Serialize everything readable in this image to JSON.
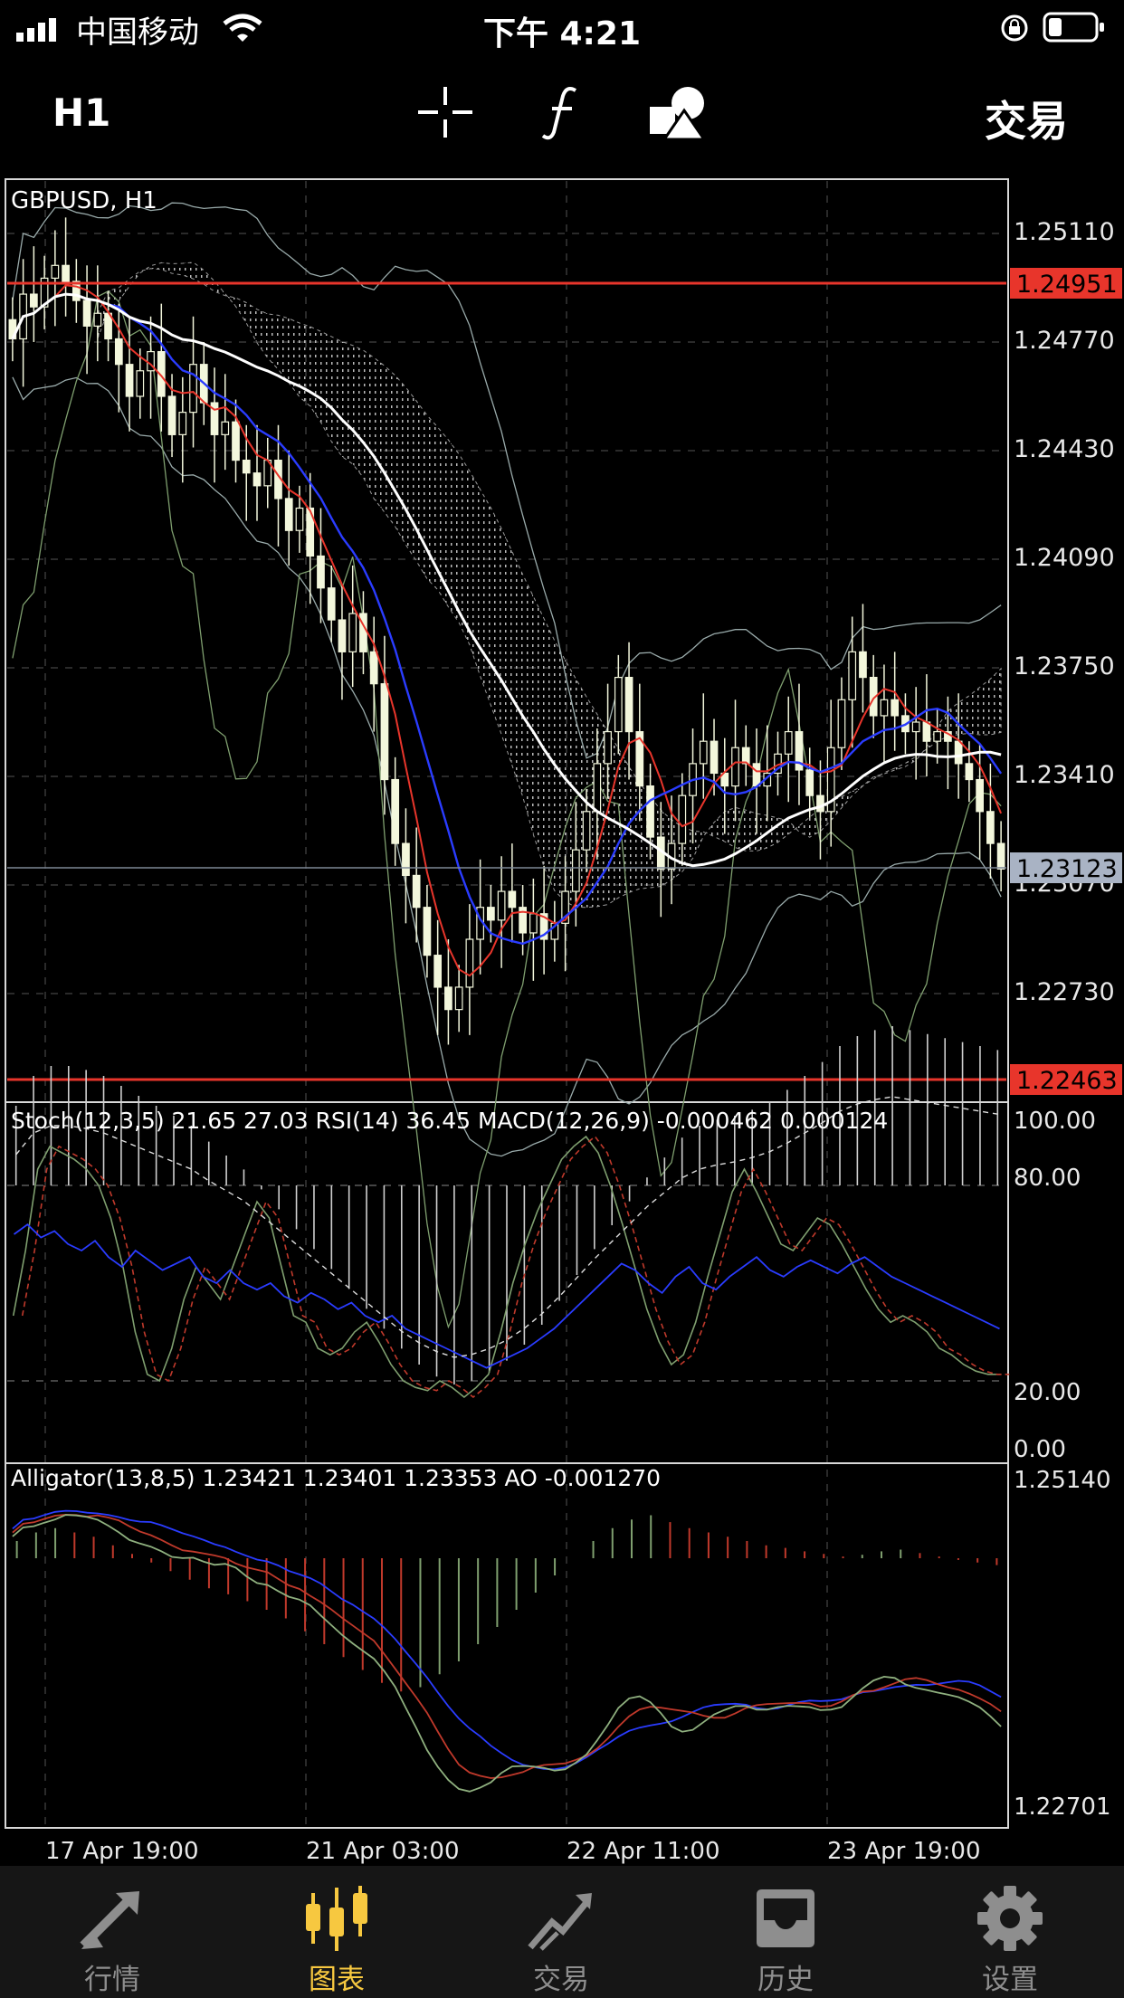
{
  "status_bar": {
    "carrier": "中国移动",
    "time": "下午 4:21"
  },
  "toolbar": {
    "timeframe": "H1",
    "trade_label": "交易",
    "icons": [
      "crosshair-icon",
      "function-icon",
      "shapes-icon"
    ]
  },
  "main_chart": {
    "symbol_label": "GBPUSD, H1",
    "price_labels": [
      "1.25110",
      "1.24770",
      "1.24430",
      "1.24090",
      "1.23750",
      "1.23410",
      "1.23070",
      "1.22730"
    ],
    "levels": {
      "upper_red": "1.24951",
      "lower_red": "1.22463",
      "current": "1.23123"
    }
  },
  "indicator1": {
    "label": "Stoch(12,3,5) 21.65 27.03 RSI(14) 36.45 MACD(12,26,9) -0.000462 0.000124",
    "scale": [
      "100.00",
      "80.00",
      "20.00",
      "0.00"
    ]
  },
  "indicator2": {
    "label": "Alligator(13,8,5) 1.23421 1.23401 1.23353 AO -0.001270",
    "scale": [
      "1.25140",
      "1.22701"
    ]
  },
  "time_axis": [
    "17 Apr 19:00",
    "21 Apr 03:00",
    "22 Apr 11:00",
    "23 Apr 19:00"
  ],
  "chart_data": {
    "type": "candlestick",
    "symbol": "GBPUSD",
    "ylim": [
      1.2246,
      1.2528
    ],
    "close": [
      1.2478,
      1.2492,
      1.2488,
      1.2497,
      1.2501,
      1.2496,
      1.249,
      1.2482,
      1.2486,
      1.2478,
      1.247,
      1.246,
      1.2468,
      1.2474,
      1.246,
      1.2448,
      1.2455,
      1.247,
      1.2458,
      1.2448,
      1.2452,
      1.244,
      1.2436,
      1.2432,
      1.244,
      1.2428,
      1.2418,
      1.2425,
      1.241,
      1.24,
      1.239,
      1.238,
      1.2392,
      1.238,
      1.237,
      1.234,
      1.232,
      1.231,
      1.23,
      1.2285,
      1.2275,
      1.2268,
      1.2275,
      1.229,
      1.23,
      1.2296,
      1.2305,
      1.23,
      1.2292,
      1.2298,
      1.229,
      1.2295,
      1.2305,
      1.2318,
      1.233,
      1.2345,
      1.2355,
      1.2372,
      1.2355,
      1.2338,
      1.2322,
      1.2312,
      1.232,
      1.2335,
      1.2345,
      1.2352,
      1.2342,
      1.2338,
      1.235,
      1.2345,
      1.2338,
      1.2342,
      1.2348,
      1.2355,
      1.2343,
      1.2335,
      1.233,
      1.235,
      1.2365,
      1.238,
      1.2372,
      1.236,
      1.2365,
      1.236,
      1.2355,
      1.2358,
      1.2352,
      1.2355,
      1.2352,
      1.2345,
      1.234,
      1.233,
      1.232,
      1.2312
    ],
    "stoch_main": [
      40,
      60,
      85,
      92,
      90,
      88,
      85,
      80,
      70,
      55,
      35,
      22,
      20,
      30,
      45,
      55,
      50,
      45,
      55,
      65,
      75,
      70,
      55,
      40,
      38,
      30,
      28,
      30,
      35,
      38,
      32,
      25,
      20,
      18,
      17,
      20,
      18,
      15,
      18,
      22,
      35,
      50,
      62,
      72,
      80,
      88,
      92,
      95,
      90,
      80,
      68,
      55,
      42,
      32,
      25,
      28,
      38,
      52,
      65,
      78,
      85,
      78,
      70,
      62,
      60,
      65,
      70,
      68,
      62,
      55,
      48,
      42,
      38,
      40,
      38,
      35,
      30,
      28,
      25,
      23,
      22,
      22
    ],
    "rsi": [
      65,
      68,
      64,
      66,
      62,
      60,
      63,
      58,
      55,
      60,
      57,
      54,
      56,
      58,
      52,
      50,
      54,
      50,
      48,
      50,
      46,
      44,
      47,
      45,
      42,
      44,
      40,
      38,
      40,
      36,
      34,
      32,
      30,
      28,
      26,
      24,
      26,
      28,
      30,
      33,
      36,
      40,
      44,
      48,
      52,
      56,
      54,
      50,
      47,
      52,
      55,
      50,
      48,
      52,
      55,
      58,
      54,
      52,
      55,
      57,
      55,
      53,
      56,
      58,
      55,
      52,
      50,
      48,
      46,
      44,
      42,
      40,
      38,
      36
    ],
    "macd_hist": [
      0.4,
      0.55,
      0.6,
      0.6,
      0.58,
      0.55,
      0.5,
      0.45,
      0.4,
      0.35,
      0.3,
      0.22,
      0.15,
      0.08,
      -0.02,
      -0.12,
      -0.22,
      -0.32,
      -0.42,
      -0.52,
      -0.62,
      -0.72,
      -0.82,
      -0.9,
      -0.96,
      -1.0,
      -0.98,
      -0.94,
      -0.88,
      -0.8,
      -0.7,
      -0.58,
      -0.45,
      -0.32,
      -0.2,
      -0.08,
      0.04,
      0.14,
      0.24,
      0.3,
      0.33,
      0.35,
      0.38,
      0.42,
      0.48,
      0.55,
      0.62,
      0.7,
      0.75,
      0.78,
      0.8,
      0.78,
      0.76,
      0.74,
      0.72,
      0.7,
      0.68
    ],
    "ao_hist": [
      0.2,
      0.3,
      0.35,
      0.3,
      0.25,
      0.15,
      0.05,
      -0.05,
      -0.15,
      -0.25,
      -0.35,
      -0.42,
      -0.5,
      -0.6,
      -0.7,
      -0.85,
      -1.0,
      -1.15,
      -1.3,
      -1.45,
      -1.55,
      -1.5,
      -1.35,
      -1.2,
      -1.0,
      -0.8,
      -0.6,
      -0.4,
      -0.2,
      0.0,
      0.2,
      0.35,
      0.45,
      0.5,
      0.42,
      0.35,
      0.3,
      0.25,
      0.2,
      0.15,
      0.12,
      0.08,
      0.05,
      0.02,
      0.04,
      0.08,
      0.1,
      0.06,
      0.02,
      -0.02,
      -0.05,
      -0.08
    ]
  },
  "bottom_tabs": [
    {
      "label": "行情",
      "icon": "quotes-icon",
      "active": false
    },
    {
      "label": "图表",
      "icon": "chart-icon",
      "active": true
    },
    {
      "label": "交易",
      "icon": "trade-icon",
      "active": false
    },
    {
      "label": "历史",
      "icon": "history-icon",
      "active": false
    },
    {
      "label": "设置",
      "icon": "settings-icon",
      "active": false
    }
  ],
  "colors": {
    "accent": "#f7c840",
    "red_line": "#e8352b",
    "tab_inactive": "#8e8e8e",
    "candle": "#f3f7dc",
    "blue_line": "#2a3cff"
  }
}
